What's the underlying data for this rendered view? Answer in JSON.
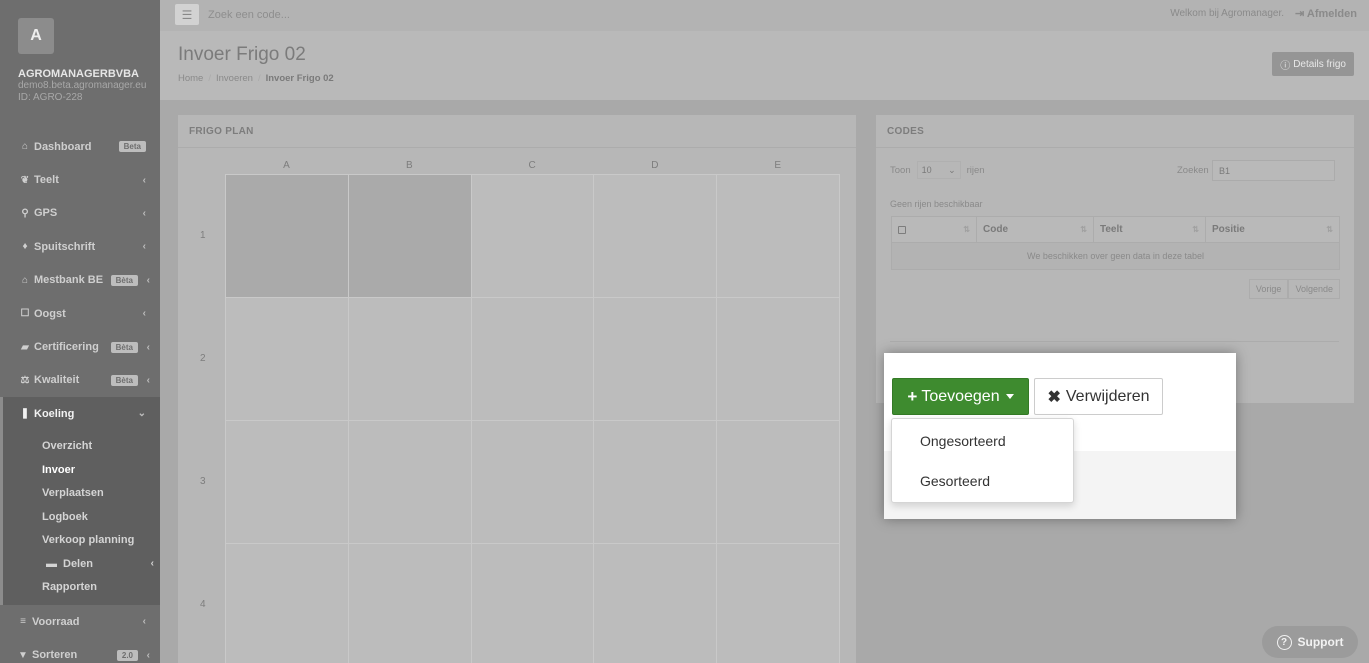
{
  "sidebar": {
    "logo_letter": "A",
    "company": "AGROMANAGERBVBA",
    "domain": "demo8.beta.agromanager.eu",
    "id": "ID: AGRO-228",
    "items": [
      {
        "label": "Dashboard",
        "icon": "home-icon",
        "glyph": "⌂",
        "badge": "Beta"
      },
      {
        "label": "Teelt",
        "icon": "leaf-icon",
        "glyph": "❦",
        "arrow": "‹"
      },
      {
        "label": "GPS",
        "icon": "map-marker-icon",
        "glyph": "⚲",
        "arrow": "‹"
      },
      {
        "label": "Spuitschrift",
        "icon": "droplet-icon",
        "glyph": "♦",
        "arrow": "‹"
      },
      {
        "label": "Mestbank BE",
        "icon": "bank-icon",
        "glyph": "⌂",
        "badge": "Bèta",
        "arrow": "‹"
      },
      {
        "label": "Oogst",
        "icon": "basket-icon",
        "glyph": "☐",
        "arrow": "‹"
      },
      {
        "label": "Certificering",
        "icon": "certificate-icon",
        "glyph": "▰",
        "badge": "Bèta",
        "arrow": "‹"
      },
      {
        "label": "Kwaliteit",
        "icon": "balance-icon",
        "glyph": "⚖",
        "badge": "Bèta",
        "arrow": "‹"
      },
      {
        "label": "Koeling",
        "icon": "thermometer-icon",
        "glyph": "❚",
        "arrow": "⌄"
      }
    ],
    "subitems": [
      {
        "label": "Overzicht"
      },
      {
        "label": "Invoer"
      },
      {
        "label": "Verplaatsen"
      },
      {
        "label": "Logboek"
      },
      {
        "label": "Verkoop planning"
      },
      {
        "label": "Delen",
        "arrow": "‹"
      },
      {
        "label": "Rapporten"
      }
    ],
    "bottom_items": [
      {
        "label": "Voorraad",
        "icon": "list-icon",
        "glyph": "≡",
        "arrow": "‹"
      },
      {
        "label": "Sorteren",
        "icon": "filter-icon",
        "glyph": "▼",
        "badge": "2.0",
        "arrow": "‹"
      }
    ]
  },
  "topbar": {
    "search_placeholder": "Zoek een code...",
    "welcome": "Welkom bij Agromanager.",
    "logout": "Afmelden"
  },
  "header": {
    "title": "Invoer Frigo 02",
    "breadcrumb": [
      "Home",
      "Invoeren",
      "Invoer Frigo 02"
    ],
    "details_button": "Details frigo"
  },
  "frigo": {
    "title": "FRIGO PLAN",
    "columns": [
      "A",
      "B",
      "C",
      "D",
      "E"
    ],
    "rows": [
      "1",
      "2",
      "3",
      "4"
    ],
    "filled_cells": [
      "1A",
      "1B"
    ]
  },
  "codes": {
    "title": "CODES",
    "show_label": "Toon",
    "show_value": "10",
    "rows_label": "rijen",
    "search_label": "Zoeken",
    "search_value": "B1",
    "no_rows": "Geen rijen beschikbaar",
    "columns": [
      "Code",
      "Teelt",
      "Positie"
    ],
    "empty_message": "We beschikken over geen data in deze tabel",
    "prev": "Vorige",
    "next": "Volgende"
  },
  "popup": {
    "add_label": "Toevoegen",
    "delete_label": "Verwijderen",
    "dropdown_items": [
      "Ongesorteerd",
      "Gesorteerd"
    ]
  },
  "support": {
    "label": "Support"
  }
}
